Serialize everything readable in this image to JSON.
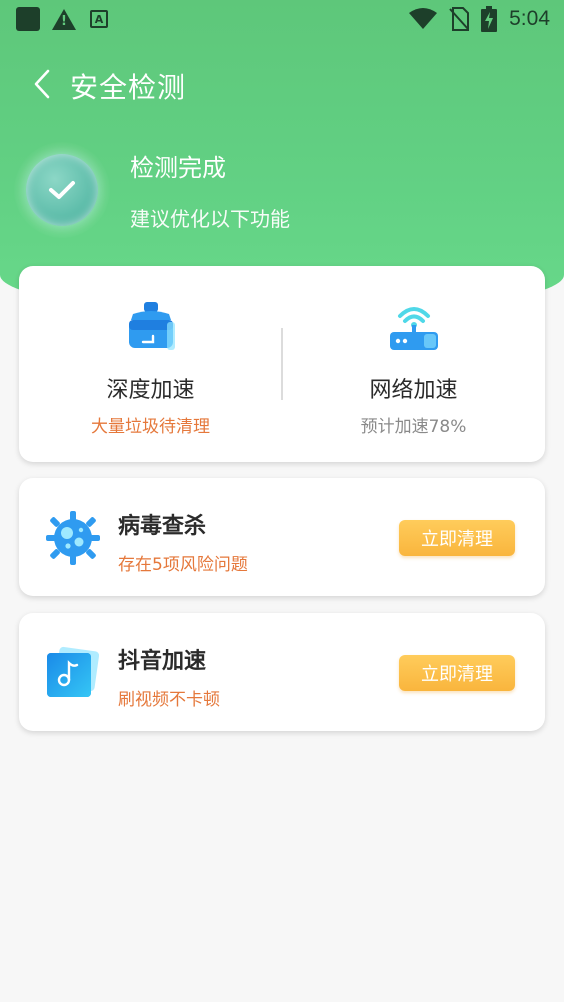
{
  "status_bar": {
    "time": "5:04"
  },
  "header": {
    "title": "安全检测"
  },
  "scan_status": {
    "title": "检测完成",
    "subtitle": "建议优化以下功能"
  },
  "features": [
    {
      "title": "深度加速",
      "subtitle": "大量垃圾待清理",
      "subtitle_color": "#e5783b",
      "icon": "broom-icon"
    },
    {
      "title": "网络加速",
      "subtitle": "预计加速78%",
      "subtitle_color": "#8a8a8a",
      "icon": "router-wifi-icon"
    }
  ],
  "items": [
    {
      "title": "病毒查杀",
      "subtitle": "存在5项风险问题",
      "button_label": "立即清理",
      "icon": "virus-icon"
    },
    {
      "title": "抖音加速",
      "subtitle": "刷视频不卡顿",
      "button_label": "立即清理",
      "icon": "music-note-icon"
    }
  ],
  "colors": {
    "header_green": "#62d184",
    "accent_orange": "#e5783b",
    "button_yellow": "#f9b53d",
    "icon_blue": "#2f9bf0"
  }
}
